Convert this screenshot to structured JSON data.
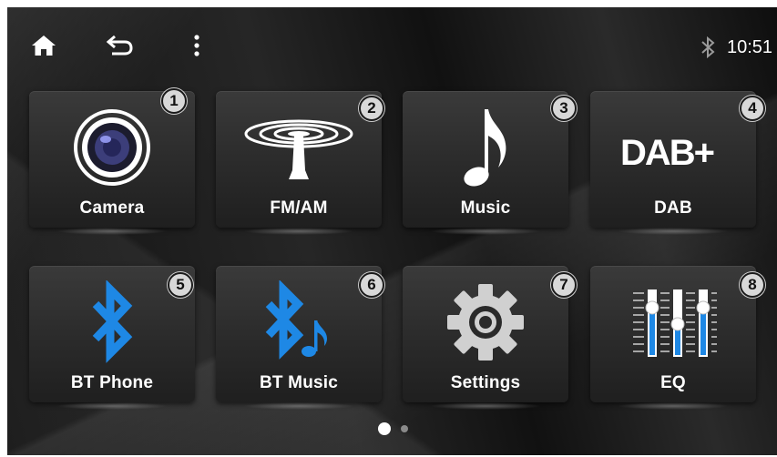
{
  "status_bar": {
    "home_icon": "home-icon",
    "back_icon": "back-arrow-icon",
    "menu_icon": "more-vertical-icon",
    "bluetooth_icon": "bluetooth-icon",
    "time": "10:51"
  },
  "apps": [
    {
      "label": "Camera",
      "badge": "1",
      "icon": "camera-icon"
    },
    {
      "label": "FM/AM",
      "badge": "2",
      "icon": "radio-antenna-icon"
    },
    {
      "label": "Music",
      "badge": "3",
      "icon": "music-note-icon"
    },
    {
      "label": "DAB",
      "badge": "4",
      "icon": "dab-plus-icon",
      "icon_text": "DAB+"
    },
    {
      "label": "BT Phone",
      "badge": "5",
      "icon": "bluetooth-icon"
    },
    {
      "label": "BT Music",
      "badge": "6",
      "icon": "bluetooth-music-icon"
    },
    {
      "label": "Settings",
      "badge": "7",
      "icon": "gear-icon"
    },
    {
      "label": "EQ",
      "badge": "8",
      "icon": "equalizer-icon"
    }
  ],
  "pager": {
    "pages": 2,
    "current": 1
  },
  "colors": {
    "accent_blue": "#1e88e5",
    "background": "#1a1a1a",
    "tile": "#2e2e2e"
  }
}
